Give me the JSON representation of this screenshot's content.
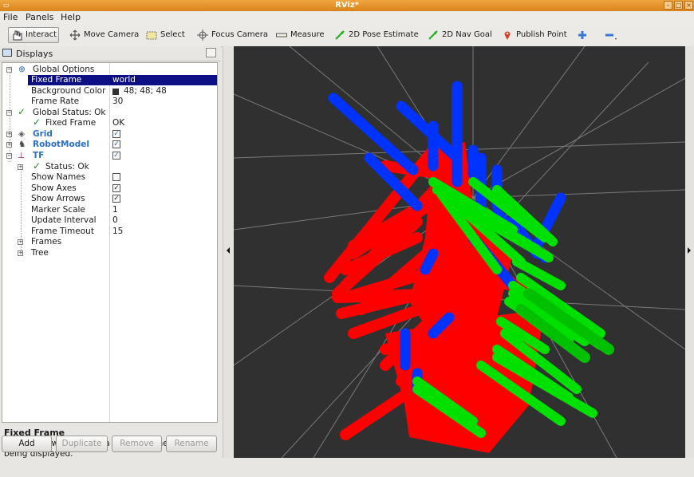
{
  "window": {
    "title": "RViz*"
  },
  "menu": [
    "File",
    "Panels",
    "Help"
  ],
  "toolbar": {
    "tools": [
      "Interact",
      "Move Camera",
      "Select",
      "Focus Camera",
      "Measure",
      "2D Pose Estimate",
      "2D Nav Goal",
      "Publish Point"
    ],
    "active_tool": "Interact"
  },
  "displays_panel": {
    "title": "Displays",
    "rows": [
      {
        "name": "Global Options",
        "value": ""
      },
      {
        "name": "Fixed Frame",
        "value": "world"
      },
      {
        "name": "Background Color",
        "value": "48; 48; 48"
      },
      {
        "name": "Frame Rate",
        "value": "30"
      },
      {
        "name": "Global Status: Ok",
        "value": ""
      },
      {
        "name": "Fixed Frame",
        "value": "OK"
      },
      {
        "name": "Grid",
        "value": ""
      },
      {
        "name": "RobotModel",
        "value": ""
      },
      {
        "name": "TF",
        "value": ""
      },
      {
        "name": "Status: Ok",
        "value": ""
      },
      {
        "name": "Show Names",
        "value": ""
      },
      {
        "name": "Show Axes",
        "value": ""
      },
      {
        "name": "Show Arrows",
        "value": ""
      },
      {
        "name": "Marker Scale",
        "value": "1"
      },
      {
        "name": "Update Interval",
        "value": "0"
      },
      {
        "name": "Frame Timeout",
        "value": "15"
      },
      {
        "name": "Frames",
        "value": ""
      },
      {
        "name": "Tree",
        "value": ""
      }
    ],
    "checkboxes": {
      "grid": true,
      "robot_model": true,
      "tf": true,
      "show_names": false,
      "show_axes": true,
      "show_arrows": true
    },
    "background_swatch": "#303030"
  },
  "help": {
    "title": "Fixed Frame",
    "text": "Frame into which all data is transformed before being displayed."
  },
  "buttons": {
    "add": "Add",
    "duplicate": "Duplicate",
    "remove": "Remove",
    "rename": "Rename"
  },
  "viewport": {
    "background": "#303030",
    "axis_colors": {
      "x": "#ff0000",
      "y": "#00ff00",
      "z": "#0000ff"
    }
  }
}
